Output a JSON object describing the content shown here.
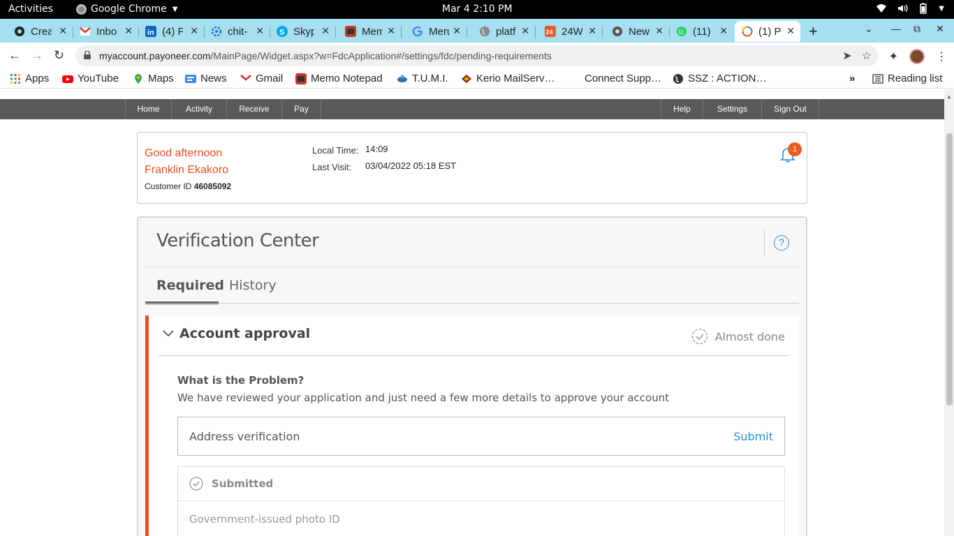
{
  "os": {
    "activities": "Activities",
    "app_name": "Google Chrome",
    "clock": "Mar 4  2:10 PM"
  },
  "tabs": [
    {
      "title": "Crea",
      "icon": "github-icon"
    },
    {
      "title": "Inbo",
      "icon": "gmail-icon"
    },
    {
      "title": "(4) F",
      "icon": "linkedin-icon"
    },
    {
      "title": "chit-",
      "icon": "gear-icon"
    },
    {
      "title": "Skyp",
      "icon": "skype-icon"
    },
    {
      "title": "Mem",
      "icon": "memo-icon"
    },
    {
      "title": "Meru",
      "icon": "google-icon"
    },
    {
      "title": "platf",
      "icon": "globe-icon"
    },
    {
      "title": "24W",
      "icon": "24-icon"
    },
    {
      "title": "New",
      "icon": "chrome-icon"
    },
    {
      "title": "(11)",
      "icon": "whatsapp-icon"
    },
    {
      "title": "(1) P",
      "icon": "payoneer-icon",
      "active": true
    }
  ],
  "browser": {
    "url_host": "myaccount.payoneer.com",
    "url_path": "/MainPage/Widget.aspx?w=FdcApplication#/settings/fdc/pending-requirements"
  },
  "bookmarks": [
    {
      "label": "Apps",
      "icon": "apps-grid-icon"
    },
    {
      "label": "YouTube",
      "icon": "youtube-icon"
    },
    {
      "label": "Maps",
      "icon": "maps-icon"
    },
    {
      "label": "News",
      "icon": "news-icon"
    },
    {
      "label": "Gmail",
      "icon": "gmail-icon"
    },
    {
      "label": "Memo Notepad",
      "icon": "memo-icon"
    },
    {
      "label": "T.U.M.I.",
      "icon": "tumi-icon"
    },
    {
      "label": "Kerio MailServ…",
      "icon": "kerio-icon"
    },
    {
      "label": "Connect Supp…",
      "icon": "blank-icon"
    },
    {
      "label": "SSZ : ACTION…",
      "icon": "globe-icon"
    }
  ],
  "bookmarks_more": "»",
  "reading_list": "Reading list",
  "site_nav": {
    "left": [
      "Home",
      "Activity",
      "Receive",
      "Pay"
    ],
    "right": [
      "Help",
      "Settings",
      "Sign Out"
    ]
  },
  "welcome": {
    "greeting": "Good afternoon",
    "name": "Franklin Ekakoro",
    "customer_id_label": "Customer ID",
    "customer_id": "46085092",
    "local_time_label": "Local Time:",
    "local_time": "14:09",
    "last_visit_label": "Last Visit:",
    "last_visit": "03/04/2022 05:18 EST",
    "notification_count": "1"
  },
  "verification": {
    "title": "Verification Center",
    "help": "?",
    "tabs": [
      "Required",
      "History"
    ],
    "card": {
      "title": "Account approval",
      "status": "Almost done",
      "problem_title": "What is the Problem?",
      "problem_desc": "We have reviewed your application and just need a few more details to approve your account",
      "requirement": "Address verification",
      "submit": "Submit",
      "submitted_label": "Submitted",
      "submitted_item": "Government-issued photo ID"
    }
  },
  "colors": {
    "accent_orange": "#e8501f",
    "link_blue": "#2a8fd6",
    "tabstrip": "#a6dff0",
    "nav_gray": "#595959"
  }
}
